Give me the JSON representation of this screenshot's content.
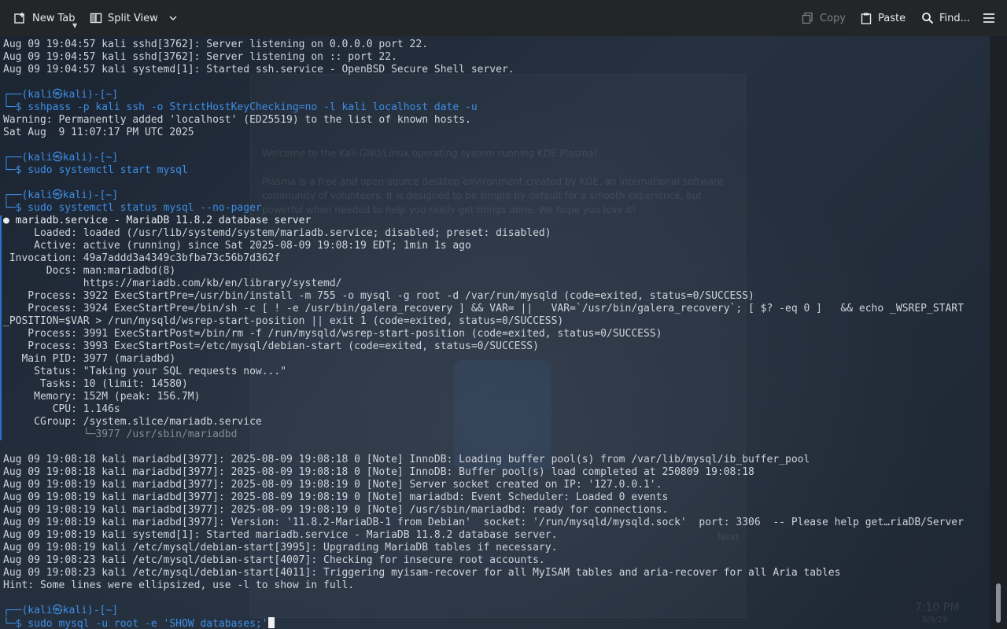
{
  "toolbar": {
    "new_tab": "New Tab",
    "split_view": "Split View",
    "copy": "Copy",
    "paste": "Paste",
    "find": "Find..."
  },
  "background": {
    "welcome": "Welcome to the Kali GNU/Linux operating system running KDE Plasma!",
    "plasma_1": "Plasma is a free and open-source desktop environment created by KDE, an international software",
    "plasma_2": "community of volunteers. It is designed to be simple by default for a smooth experience, but",
    "plasma_3": "powerful when needed to help you really get things done. We hope you love it!",
    "next": "Next",
    "clock": "7:10 PM",
    "date": "8/9/25"
  },
  "terminal": {
    "lines": [
      "Aug 09 19:04:57 kali sshd[3762]: Server listening on 0.0.0.0 port 22.",
      "Aug 09 19:04:57 kali sshd[3762]: Server listening on :: port 22.",
      "Aug 09 19:04:57 kali systemd[1]: Started ssh.service - OpenBSD Secure Shell server.",
      "",
      "┌──(kali㉿kali)-[~]",
      "└─$ sshpass -p kali ssh -o StrictHostKeyChecking=no -l kali localhost date -u",
      "Warning: Permanently added 'localhost' (ED25519) to the list of known hosts.",
      "Sat Aug  9 11:07:17 PM UTC 2025",
      "",
      "┌──(kali㉿kali)-[~]",
      "└─$ sudo systemctl start mysql",
      "",
      "┌──(kali㉿kali)-[~]",
      "└─$ sudo systemctl status mysql --no-pager",
      "● mariadb.service - MariaDB 11.8.2 database server",
      "     Loaded: loaded (/usr/lib/systemd/system/mariadb.service; disabled; preset: disabled)",
      "     Active: active (running) since Sat 2025-08-09 19:08:19 EDT; 1min 1s ago",
      " Invocation: 49a7addd3a4349c3bfba73c56b7d362f",
      "       Docs: man:mariadbd(8)",
      "             https://mariadb.com/kb/en/library/systemd/",
      "    Process: 3922 ExecStartPre=/usr/bin/install -m 755 -o mysql -g root -d /var/run/mysqld (code=exited, status=0/SUCCESS)",
      "    Process: 3924 ExecStartPre=/bin/sh -c [ ! -e /usr/bin/galera_recovery ] && VAR= ||   VAR=`/usr/bin/galera_recovery`; [ $? -eq 0 ]   && echo _WSREP_START",
      "_POSITION=$VAR > /run/mysqld/wsrep-start-position || exit 1 (code=exited, status=0/SUCCESS)",
      "    Process: 3991 ExecStartPost=/bin/rm -f /run/mysqld/wsrep-start-position (code=exited, status=0/SUCCESS)",
      "    Process: 3993 ExecStartPost=/etc/mysql/debian-start (code=exited, status=0/SUCCESS)",
      "   Main PID: 3977 (mariadbd)",
      "     Status: \"Taking your SQL requests now...\"",
      "      Tasks: 10 (limit: 14580)",
      "     Memory: 152M (peak: 156.7M)",
      "        CPU: 1.146s",
      "     CGroup: /system.slice/mariadb.service",
      "             └─3977 /usr/sbin/mariadbd",
      "",
      "Aug 09 19:08:18 kali mariadbd[3977]: 2025-08-09 19:08:18 0 [Note] InnoDB: Loading buffer pool(s) from /var/lib/mysql/ib_buffer_pool",
      "Aug 09 19:08:18 kali mariadbd[3977]: 2025-08-09 19:08:18 0 [Note] InnoDB: Buffer pool(s) load completed at 250809 19:08:18",
      "Aug 09 19:08:19 kali mariadbd[3977]: 2025-08-09 19:08:19 0 [Note] Server socket created on IP: '127.0.0.1'.",
      "Aug 09 19:08:19 kali mariadbd[3977]: 2025-08-09 19:08:19 0 [Note] mariadbd: Event Scheduler: Loaded 0 events",
      "Aug 09 19:08:19 kali mariadbd[3977]: 2025-08-09 19:08:19 0 [Note] /usr/sbin/mariadbd: ready for connections.",
      "Aug 09 19:08:19 kali mariadbd[3977]: Version: '11.8.2-MariaDB-1 from Debian'  socket: '/run/mysqld/mysqld.sock'  port: 3306  -- Please help get…riaDB/Server",
      "Aug 09 19:08:19 kali systemd[1]: Started mariadb.service - MariaDB 11.8.2 database server.",
      "Aug 09 19:08:19 kali /etc/mysql/debian-start[3995]: Upgrading MariaDB tables if necessary.",
      "Aug 09 19:08:23 kali /etc/mysql/debian-start[4007]: Checking for insecure root accounts.",
      "Aug 09 19:08:23 kali /etc/mysql/debian-start[4011]: Triggering myisam-recover for all MyISAM tables and aria-recover for all Aria tables",
      "Hint: Some lines were ellipsized, use -l to show in full.",
      "",
      "┌──(kali㉿kali)-[~]",
      "└─$ sudo mysql -u root -e 'SHOW databases;'"
    ]
  }
}
